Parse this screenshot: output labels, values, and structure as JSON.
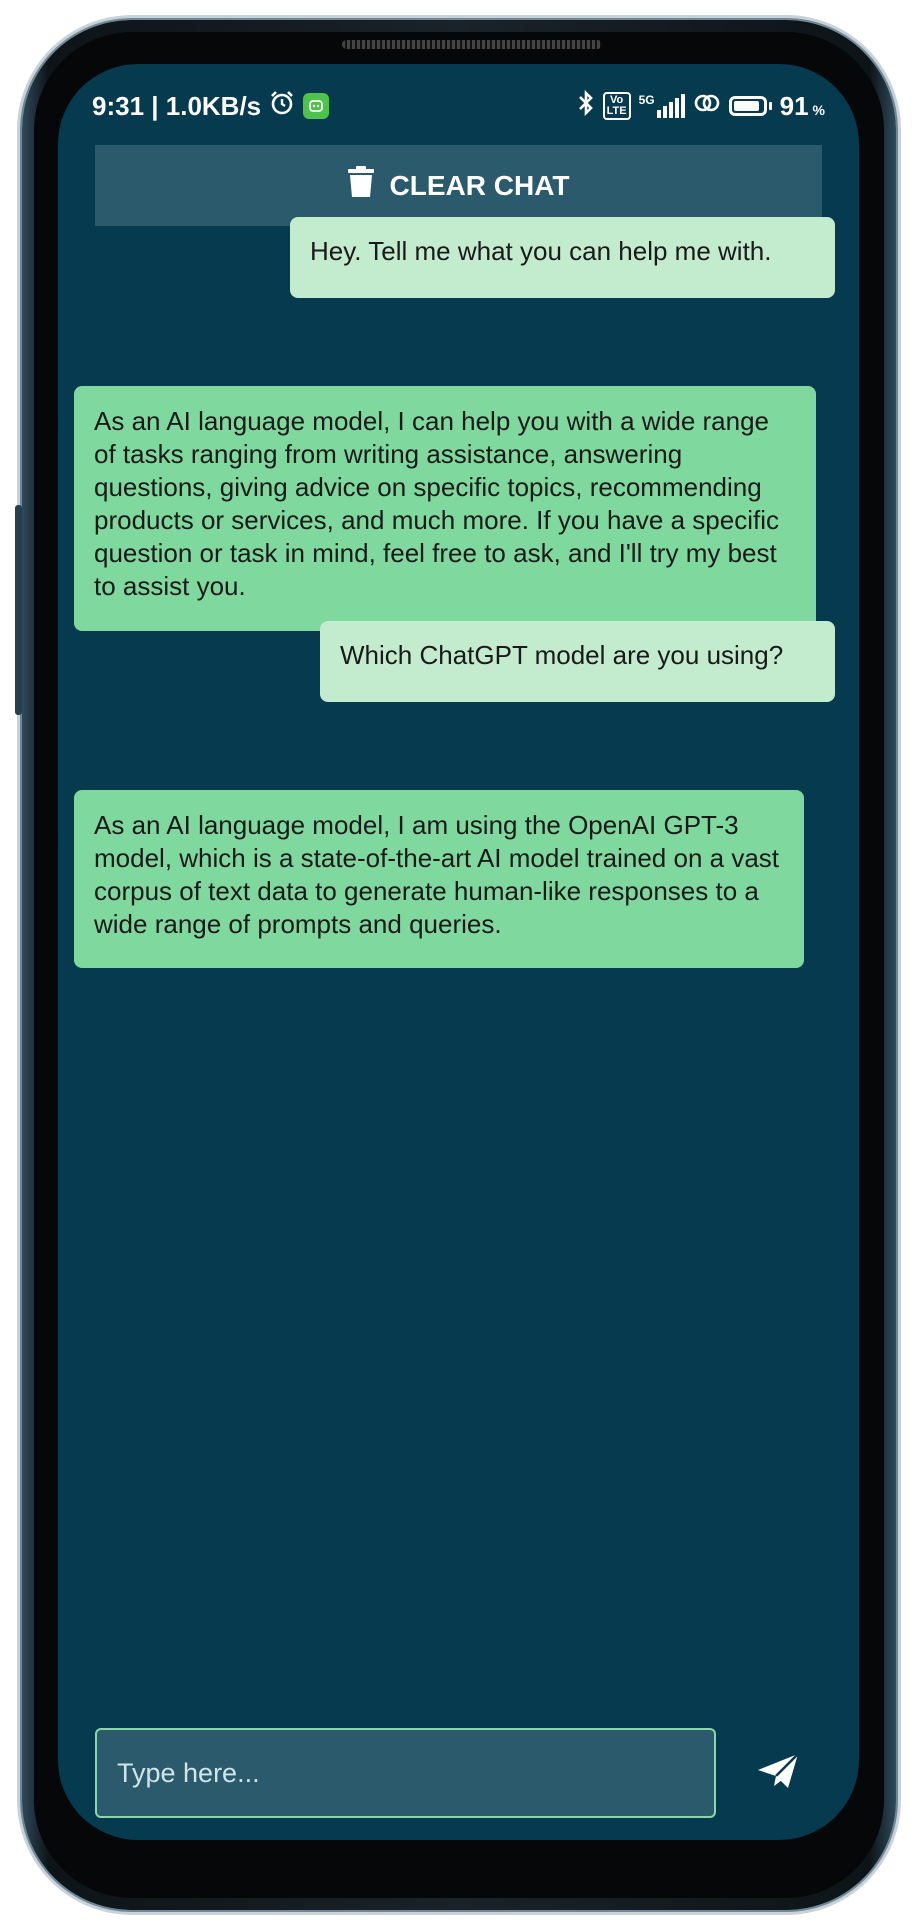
{
  "status_bar": {
    "time_speed": "9:31 | 1.0KB/s",
    "network_badge_top": "Vo",
    "network_badge_bottom": "LTE",
    "network_type": "5G",
    "battery_percent": "91",
    "battery_unit": "%",
    "battery_level": 0.91
  },
  "toolbar": {
    "clear_label": "CLEAR CHAT"
  },
  "messages": [
    {
      "role": "user",
      "text": "Hey. Tell me what you can help me with."
    },
    {
      "role": "bot",
      "text": "As an AI language model, I can help you with a wide range of tasks ranging from writing assistance, answering questions, giving advice on specific topics, recommending products or services, and much more. If you have a specific question or task in mind, feel free to ask, and I'll try my best to assist you."
    },
    {
      "role": "user",
      "text": "Which ChatGPT model are you using?"
    },
    {
      "role": "bot",
      "text": "As an AI language model, I am using the OpenAI GPT-3 model, which is a state-of-the-art AI model trained on a vast corpus of text data to generate human-like responses to a wide range of prompts and queries."
    }
  ],
  "composer": {
    "placeholder": "Type here...",
    "value": ""
  },
  "colors": {
    "background": "#053a4f",
    "user_bubble": "#c3ecce",
    "bot_bubble": "#7fd89e",
    "button": "#2b5a6c",
    "input_border": "#8bd6a6"
  },
  "icons": {
    "clear": "trash-icon",
    "send": "send-icon",
    "alarm": "alarm-icon",
    "bluetooth": "bluetooth-icon",
    "signal": "signal-icon",
    "hotspot": "hotspot-icon",
    "battery": "battery-icon"
  }
}
